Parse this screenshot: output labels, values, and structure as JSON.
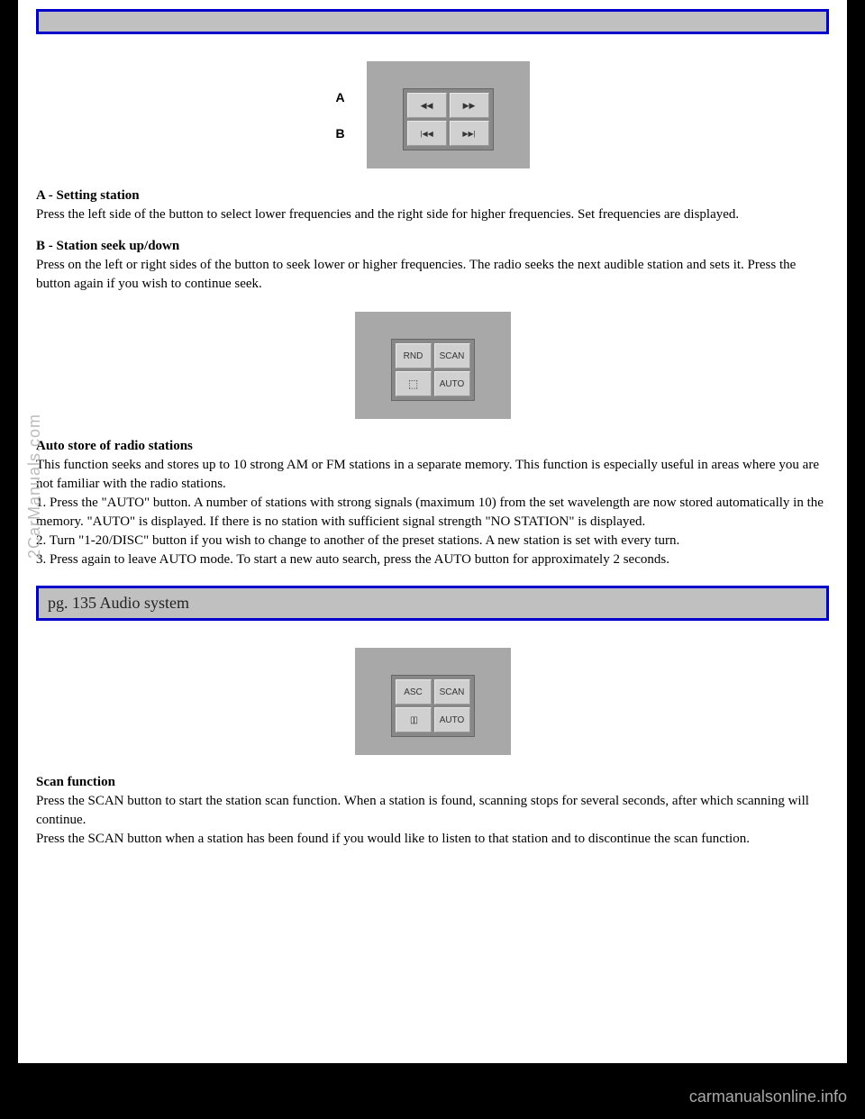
{
  "labels": {
    "a": "A",
    "b": "B"
  },
  "buttons": {
    "rnd": "RND",
    "scan": "SCAN",
    "auto": "AUTO",
    "asc": "ASC"
  },
  "section1": {
    "heading": "A - Setting station",
    "body": "Press the left side of the button to select lower frequencies and the right side for higher frequencies. Set frequencies are displayed."
  },
  "section2": {
    "heading": "B - Station seek up/down",
    "body": "Press on the left or right sides of the button to seek lower or higher frequencies. The radio seeks the next audible station and sets it. Press the button again if you wish to continue seek."
  },
  "section3": {
    "heading": "Auto store of radio stations",
    "body1": "This function seeks and stores up to 10 strong AM or FM stations in a separate memory. This function is especially useful in areas where you are not familiar with the radio stations.",
    "body2": "1. Press the \"AUTO\" button. A number of stations with strong signals (maximum 10) from the set wavelength are now stored automatically in the memory. \"AUTO\" is displayed. If there is no station with sufficient signal strength \"NO STATION\" is displayed.",
    "body3": "2. Turn \"1-20/DISC\" button if you wish to change to another of the preset stations. A new station is set with every turn.",
    "body4": "3. Press again to leave AUTO mode. To start a new auto search, press the AUTO button for approximately 2 seconds."
  },
  "pageHeader": "pg. 135 Audio system",
  "section4": {
    "heading": "Scan function",
    "body1": "Press the SCAN button to start the station scan function. When a station is found, scanning stops for several seconds, after which scanning will continue.",
    "body2": "Press the SCAN button when a station has been found if you would like to listen to that station and to discontinue the scan function."
  },
  "watermark": "2CarManuals.com",
  "footer": "carmanualsonline.info"
}
